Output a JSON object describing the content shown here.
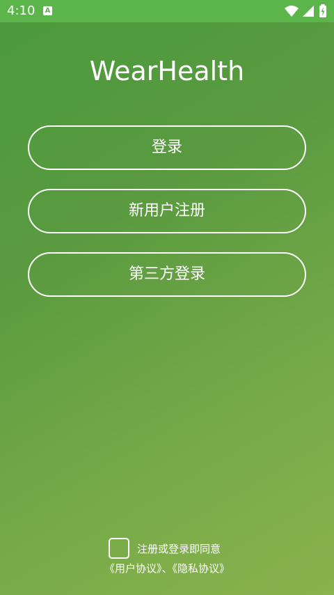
{
  "status_bar": {
    "time": "4:10",
    "notification_letter": "A",
    "icons": [
      "wifi-icon",
      "cellular-signal-icon",
      "battery-charging-icon"
    ]
  },
  "app": {
    "title": "WearHealth"
  },
  "buttons": {
    "login": "登录",
    "register": "新用户注册",
    "third_party_login": "第三方登录"
  },
  "agreement": {
    "checked": false,
    "prompt": "注册或登录即同意",
    "user_agreement": "《用户协议》",
    "separator": "、",
    "privacy_agreement": "《隐私协议》"
  },
  "colors": {
    "status_bar": "#5bb54a",
    "gradient_start": "#4a9a3c",
    "gradient_end": "#8ab24e",
    "foreground": "#ffffff"
  }
}
